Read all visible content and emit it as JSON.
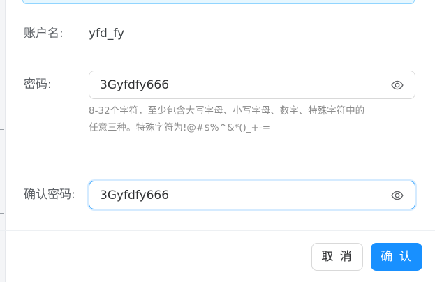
{
  "form": {
    "account_label": "账户名:",
    "account_value": "yfd_fy",
    "password_label": "密码:",
    "password_value": "3Gyfdfy666",
    "password_hint_line1": "8-32个字符，至少包含大写字母、小写字母、数字、特殊字符中的",
    "password_hint_line2": "任意三种。特殊字符为!@#$%^&*()_+-=",
    "confirm_label": "确认密码:",
    "confirm_value": "3Gyfdfy666"
  },
  "icons": {
    "password_toggle": "eye-icon",
    "confirm_toggle": "eye-icon"
  },
  "footer": {
    "cancel_label": "取 消",
    "confirm_label": "确 认"
  },
  "colors": {
    "primary": "#1890ff",
    "focus_border": "#40a9ff",
    "alert_border": "#91d5ff",
    "alert_bg": "#e6f7ff"
  }
}
